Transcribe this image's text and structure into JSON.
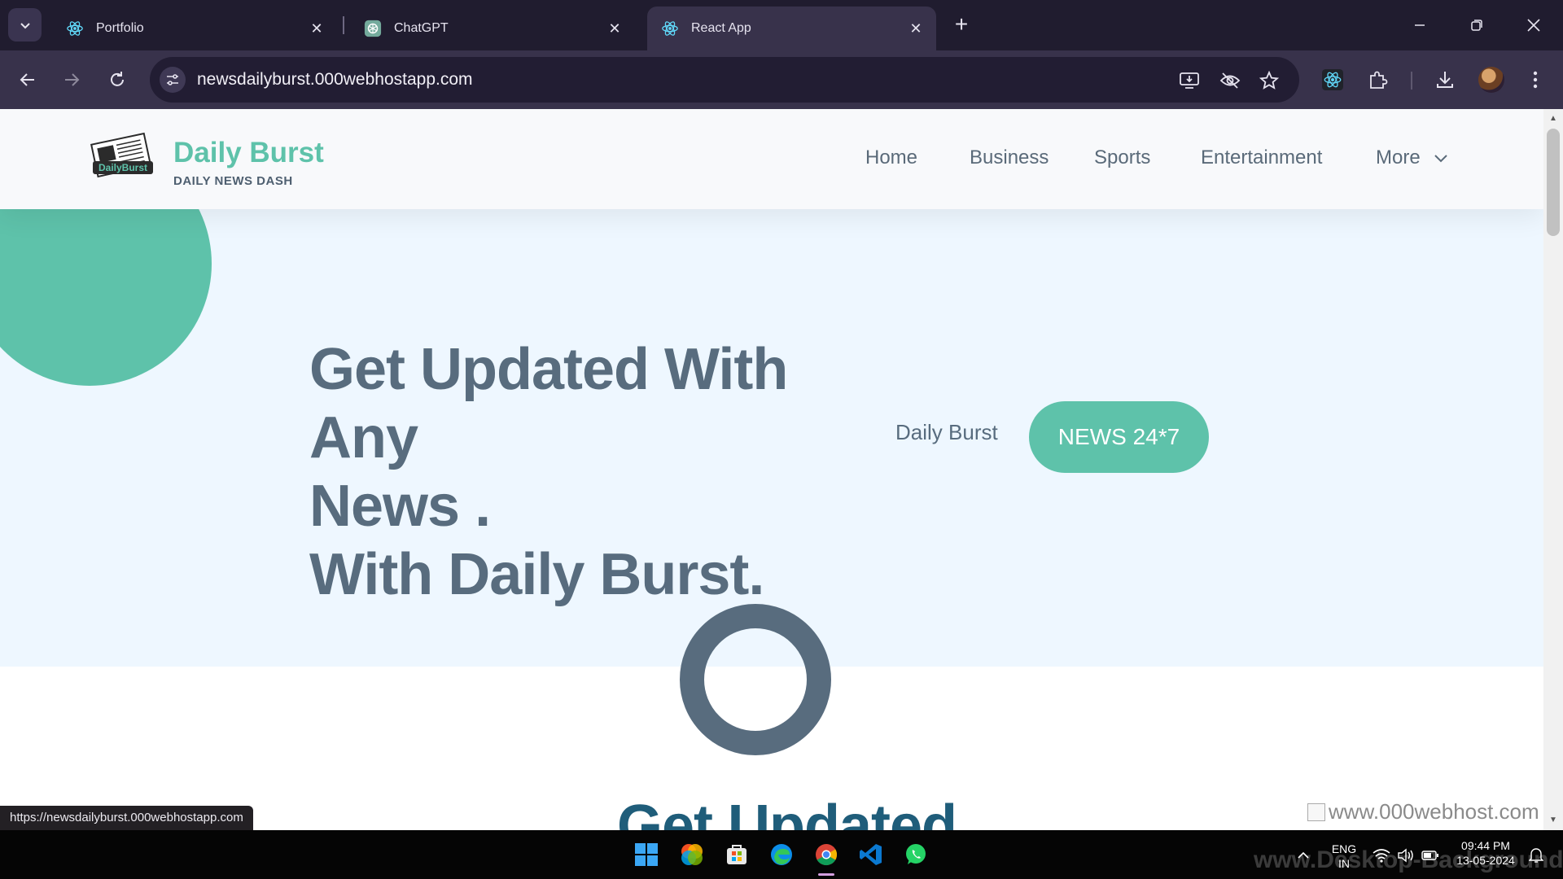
{
  "browser": {
    "tabs": [
      {
        "title": "Portfolio",
        "favicon": "react-icon",
        "active": false
      },
      {
        "title": "ChatGPT",
        "favicon": "chatgpt-icon",
        "active": false
      },
      {
        "title": "React App",
        "favicon": "react-icon",
        "active": true
      }
    ],
    "url": "newsdailyburst.000webhostapp.com",
    "status_url": "https://newsdailyburst.000webhostapp.com"
  },
  "site": {
    "logo_text": "DailyBurst",
    "brand_title": "Daily Burst",
    "brand_subtitle": "DAILY NEWS DASH",
    "nav": [
      "Home",
      "Business",
      "Sports",
      "Entertainment",
      "More"
    ],
    "hero": {
      "line1": "Get Updated With Any",
      "line2": "News .",
      "line3": "With Daily Burst.",
      "brand": "Daily Burst",
      "button": "NEWS 24*7"
    },
    "section_title": "Get Updated",
    "host_badge": "www.000webhost.com"
  },
  "colors": {
    "accent": "#5ec2aa",
    "slate": "#586c7e",
    "hero_bg": "#eef7ff",
    "browser_frame": "#201c2f"
  },
  "taskbar": {
    "apps": [
      "windows-start-icon",
      "photos-icon",
      "microsoft-store-icon",
      "edge-icon",
      "chrome-icon",
      "vscode-icon",
      "whatsapp-icon"
    ],
    "lang_top": "ENG",
    "lang_bottom": "IN",
    "time": "09:44 PM",
    "date": "13-05-2024",
    "watermark": "www.Desktop-Background.com"
  }
}
